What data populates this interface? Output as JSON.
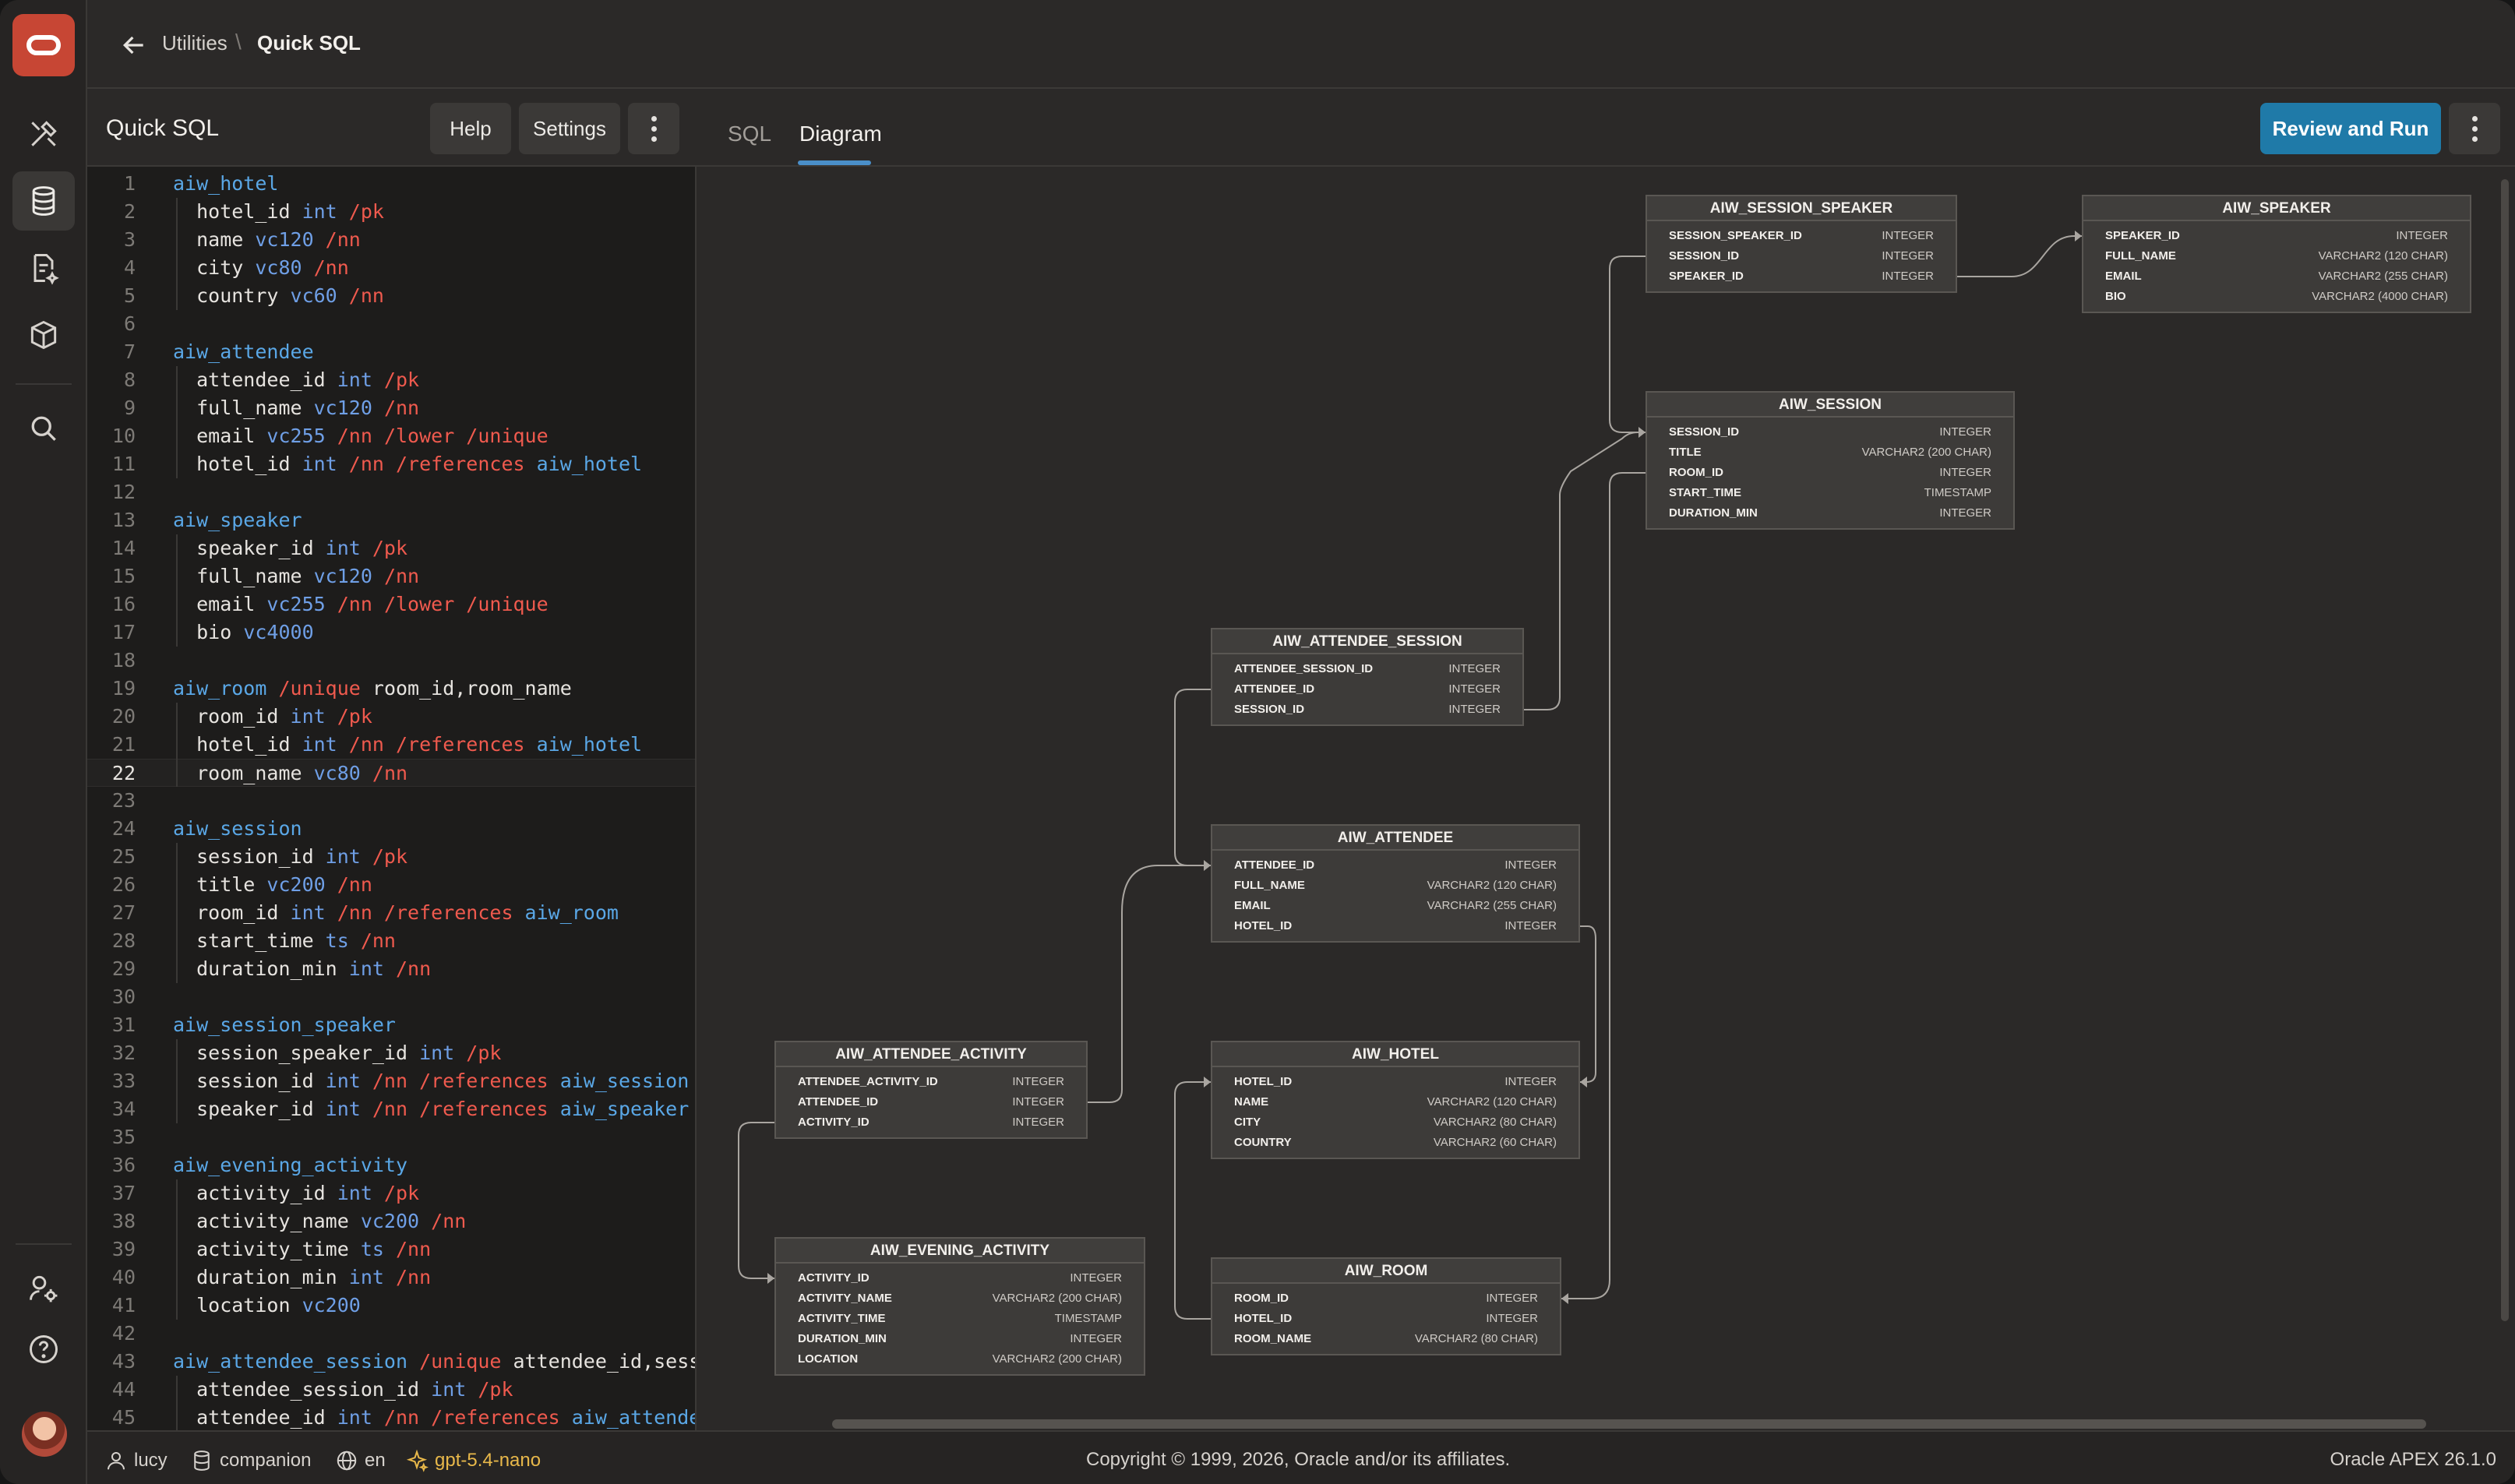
{
  "app": {
    "logo": "oracle-logo"
  },
  "rail": {
    "icons": [
      "builder-tools-icon",
      "database-icon",
      "document-ai-icon",
      "package-icon",
      "search-icon",
      "admin-settings-icon",
      "help-icon"
    ]
  },
  "breadcrumb": {
    "parent": "Utilities",
    "separator": "\\",
    "current": "Quick SQL"
  },
  "editor": {
    "title": "Quick SQL",
    "help_label": "Help",
    "settings_label": "Settings",
    "active_line": 22,
    "lines": [
      [
        {
          "c": "tbl",
          "t": "aiw_hotel"
        }
      ],
      [
        {
          "c": "col",
          "t": "  hotel_id "
        },
        {
          "c": "typ",
          "t": "int"
        },
        {
          "c": "dir",
          "t": " /pk"
        }
      ],
      [
        {
          "c": "col",
          "t": "  name "
        },
        {
          "c": "typ",
          "t": "vc120"
        },
        {
          "c": "dir",
          "t": " /nn"
        }
      ],
      [
        {
          "c": "col",
          "t": "  city "
        },
        {
          "c": "typ",
          "t": "vc80"
        },
        {
          "c": "dir",
          "t": " /nn"
        }
      ],
      [
        {
          "c": "col",
          "t": "  country "
        },
        {
          "c": "typ",
          "t": "vc60"
        },
        {
          "c": "dir",
          "t": " /nn"
        }
      ],
      [],
      [
        {
          "c": "tbl",
          "t": "aiw_attendee"
        }
      ],
      [
        {
          "c": "col",
          "t": "  attendee_id "
        },
        {
          "c": "typ",
          "t": "int"
        },
        {
          "c": "dir",
          "t": " /pk"
        }
      ],
      [
        {
          "c": "col",
          "t": "  full_name "
        },
        {
          "c": "typ",
          "t": "vc120"
        },
        {
          "c": "dir",
          "t": " /nn"
        }
      ],
      [
        {
          "c": "col",
          "t": "  email "
        },
        {
          "c": "typ",
          "t": "vc255"
        },
        {
          "c": "dir",
          "t": " /nn /lower /unique"
        }
      ],
      [
        {
          "c": "col",
          "t": "  hotel_id "
        },
        {
          "c": "typ",
          "t": "int"
        },
        {
          "c": "dir",
          "t": " /nn /references "
        },
        {
          "c": "ref",
          "t": "aiw_hotel"
        }
      ],
      [],
      [
        {
          "c": "tbl",
          "t": "aiw_speaker"
        }
      ],
      [
        {
          "c": "col",
          "t": "  speaker_id "
        },
        {
          "c": "typ",
          "t": "int"
        },
        {
          "c": "dir",
          "t": " /pk"
        }
      ],
      [
        {
          "c": "col",
          "t": "  full_name "
        },
        {
          "c": "typ",
          "t": "vc120"
        },
        {
          "c": "dir",
          "t": " /nn"
        }
      ],
      [
        {
          "c": "col",
          "t": "  email "
        },
        {
          "c": "typ",
          "t": "vc255"
        },
        {
          "c": "dir",
          "t": " /nn /lower /unique"
        }
      ],
      [
        {
          "c": "col",
          "t": "  bio "
        },
        {
          "c": "typ",
          "t": "vc4000"
        }
      ],
      [],
      [
        {
          "c": "tbl",
          "t": "aiw_room"
        },
        {
          "c": "dir",
          "t": " /unique"
        },
        {
          "c": "col",
          "t": " room_id,room_name"
        }
      ],
      [
        {
          "c": "col",
          "t": "  room_id "
        },
        {
          "c": "typ",
          "t": "int"
        },
        {
          "c": "dir",
          "t": " /pk"
        }
      ],
      [
        {
          "c": "col",
          "t": "  hotel_id "
        },
        {
          "c": "typ",
          "t": "int"
        },
        {
          "c": "dir",
          "t": " /nn /references "
        },
        {
          "c": "ref",
          "t": "aiw_hotel"
        }
      ],
      [
        {
          "c": "col",
          "t": "  room_name "
        },
        {
          "c": "typ",
          "t": "vc80"
        },
        {
          "c": "dir",
          "t": " /nn"
        }
      ],
      [],
      [
        {
          "c": "tbl",
          "t": "aiw_session"
        }
      ],
      [
        {
          "c": "col",
          "t": "  session_id "
        },
        {
          "c": "typ",
          "t": "int"
        },
        {
          "c": "dir",
          "t": " /pk"
        }
      ],
      [
        {
          "c": "col",
          "t": "  title "
        },
        {
          "c": "typ",
          "t": "vc200"
        },
        {
          "c": "dir",
          "t": " /nn"
        }
      ],
      [
        {
          "c": "col",
          "t": "  room_id "
        },
        {
          "c": "typ",
          "t": "int"
        },
        {
          "c": "dir",
          "t": " /nn /references "
        },
        {
          "c": "ref",
          "t": "aiw_room"
        }
      ],
      [
        {
          "c": "col",
          "t": "  start_time "
        },
        {
          "c": "typ",
          "t": "ts"
        },
        {
          "c": "dir",
          "t": " /nn"
        }
      ],
      [
        {
          "c": "col",
          "t": "  duration_min "
        },
        {
          "c": "typ",
          "t": "int"
        },
        {
          "c": "dir",
          "t": " /nn"
        }
      ],
      [],
      [
        {
          "c": "tbl",
          "t": "aiw_session_speaker"
        }
      ],
      [
        {
          "c": "col",
          "t": "  session_speaker_id "
        },
        {
          "c": "typ",
          "t": "int"
        },
        {
          "c": "dir",
          "t": " /pk"
        }
      ],
      [
        {
          "c": "col",
          "t": "  session_id "
        },
        {
          "c": "typ",
          "t": "int"
        },
        {
          "c": "dir",
          "t": " /nn /references "
        },
        {
          "c": "ref",
          "t": "aiw_session"
        }
      ],
      [
        {
          "c": "col",
          "t": "  speaker_id "
        },
        {
          "c": "typ",
          "t": "int"
        },
        {
          "c": "dir",
          "t": " /nn /references "
        },
        {
          "c": "ref",
          "t": "aiw_speaker"
        }
      ],
      [],
      [
        {
          "c": "tbl",
          "t": "aiw_evening_activity"
        }
      ],
      [
        {
          "c": "col",
          "t": "  activity_id "
        },
        {
          "c": "typ",
          "t": "int"
        },
        {
          "c": "dir",
          "t": " /pk"
        }
      ],
      [
        {
          "c": "col",
          "t": "  activity_name "
        },
        {
          "c": "typ",
          "t": "vc200"
        },
        {
          "c": "dir",
          "t": " /nn"
        }
      ],
      [
        {
          "c": "col",
          "t": "  activity_time "
        },
        {
          "c": "typ",
          "t": "ts"
        },
        {
          "c": "dir",
          "t": " /nn"
        }
      ],
      [
        {
          "c": "col",
          "t": "  duration_min "
        },
        {
          "c": "typ",
          "t": "int"
        },
        {
          "c": "dir",
          "t": " /nn"
        }
      ],
      [
        {
          "c": "col",
          "t": "  location "
        },
        {
          "c": "typ",
          "t": "vc200"
        }
      ],
      [],
      [
        {
          "c": "tbl",
          "t": "aiw_attendee_session"
        },
        {
          "c": "dir",
          "t": " /unique"
        },
        {
          "c": "col",
          "t": " attendee_id,sessi"
        }
      ],
      [
        {
          "c": "col",
          "t": "  attendee_session_id "
        },
        {
          "c": "typ",
          "t": "int"
        },
        {
          "c": "dir",
          "t": " /pk"
        }
      ],
      [
        {
          "c": "col",
          "t": "  attendee_id "
        },
        {
          "c": "typ",
          "t": "int"
        },
        {
          "c": "dir",
          "t": " /nn /references "
        },
        {
          "c": "ref",
          "t": "aiw_attendee"
        }
      ]
    ]
  },
  "diagram": {
    "tabs": [
      {
        "label": "SQL",
        "active": false
      },
      {
        "label": "Diagram",
        "active": true
      }
    ],
    "review_run_label": "Review and Run",
    "entities": [
      {
        "id": "AIW_SESSION_SPEAKER",
        "title": "AIW_SESSION_SPEAKER",
        "cols": [
          [
            "SESSION_SPEAKER_ID",
            "INTEGER"
          ],
          [
            "SESSION_ID",
            "INTEGER"
          ],
          [
            "SPEAKER_ID",
            "INTEGER"
          ]
        ]
      },
      {
        "id": "AIW_SPEAKER",
        "title": "AIW_SPEAKER",
        "cols": [
          [
            "SPEAKER_ID",
            "INTEGER"
          ],
          [
            "FULL_NAME",
            "VARCHAR2 (120 CHAR)"
          ],
          [
            "EMAIL",
            "VARCHAR2 (255 CHAR)"
          ],
          [
            "BIO",
            "VARCHAR2 (4000 CHAR)"
          ]
        ]
      },
      {
        "id": "AIW_SESSION",
        "title": "AIW_SESSION",
        "cols": [
          [
            "SESSION_ID",
            "INTEGER"
          ],
          [
            "TITLE",
            "VARCHAR2 (200 CHAR)"
          ],
          [
            "ROOM_ID",
            "INTEGER"
          ],
          [
            "START_TIME",
            "TIMESTAMP"
          ],
          [
            "DURATION_MIN",
            "INTEGER"
          ]
        ]
      },
      {
        "id": "AIW_ATTENDEE_SESSION",
        "title": "AIW_ATTENDEE_SESSION",
        "cols": [
          [
            "ATTENDEE_SESSION_ID",
            "INTEGER"
          ],
          [
            "ATTENDEE_ID",
            "INTEGER"
          ],
          [
            "SESSION_ID",
            "INTEGER"
          ]
        ]
      },
      {
        "id": "AIW_ATTENDEE",
        "title": "AIW_ATTENDEE",
        "cols": [
          [
            "ATTENDEE_ID",
            "INTEGER"
          ],
          [
            "FULL_NAME",
            "VARCHAR2 (120 CHAR)"
          ],
          [
            "EMAIL",
            "VARCHAR2 (255 CHAR)"
          ],
          [
            "HOTEL_ID",
            "INTEGER"
          ]
        ]
      },
      {
        "id": "AIW_ATTENDEE_ACTIVITY",
        "title": "AIW_ATTENDEE_ACTIVITY",
        "cols": [
          [
            "ATTENDEE_ACTIVITY_ID",
            "INTEGER"
          ],
          [
            "ATTENDEE_ID",
            "INTEGER"
          ],
          [
            "ACTIVITY_ID",
            "INTEGER"
          ]
        ]
      },
      {
        "id": "AIW_HOTEL",
        "title": "AIW_HOTEL",
        "cols": [
          [
            "HOTEL_ID",
            "INTEGER"
          ],
          [
            "NAME",
            "VARCHAR2 (120 CHAR)"
          ],
          [
            "CITY",
            "VARCHAR2 (80 CHAR)"
          ],
          [
            "COUNTRY",
            "VARCHAR2 (60 CHAR)"
          ]
        ]
      },
      {
        "id": "AIW_EVENING_ACTIVITY",
        "title": "AIW_EVENING_ACTIVITY",
        "cols": [
          [
            "ACTIVITY_ID",
            "INTEGER"
          ],
          [
            "ACTIVITY_NAME",
            "VARCHAR2 (200 CHAR)"
          ],
          [
            "ACTIVITY_TIME",
            "TIMESTAMP"
          ],
          [
            "DURATION_MIN",
            "INTEGER"
          ],
          [
            "LOCATION",
            "VARCHAR2 (200 CHAR)"
          ]
        ]
      },
      {
        "id": "AIW_ROOM",
        "title": "AIW_ROOM",
        "cols": [
          [
            "ROOM_ID",
            "INTEGER"
          ],
          [
            "HOTEL_ID",
            "INTEGER"
          ],
          [
            "ROOM_NAME",
            "VARCHAR2 (80 CHAR)"
          ]
        ]
      }
    ]
  },
  "footer": {
    "user": "lucy",
    "workspace": "companion",
    "language": "en",
    "model": "gpt-5.4-nano",
    "copyright": "Copyright © 1999, 2026, Oracle and/or its affiliates.",
    "version": "Oracle APEX 26.1.0"
  },
  "colors": {
    "accent": "#1f7aa8",
    "brand": "#c74634",
    "keyword_table": "#5aa7e6",
    "directive": "#ef5a4e"
  }
}
